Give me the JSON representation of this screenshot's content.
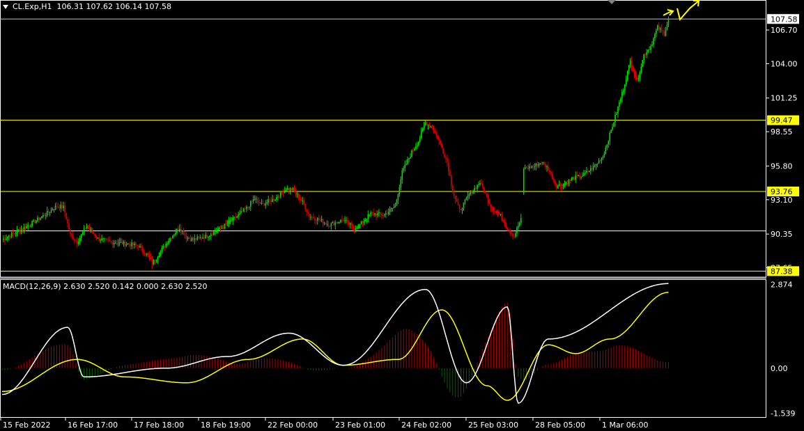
{
  "header": {
    "symbol": "CL.Exp,H1",
    "ohlc": "106.31 107.62 106.14 107.58"
  },
  "macd_header": "MACD(12,26,9) 2.630 2.520 0.142 0.000 2.630 2.520",
  "colors": {
    "background": "#000000",
    "bull_candle": "#00e000",
    "bear_candle": "#e00000",
    "level_line": "#ffff00",
    "price_line": "#c0c0c0",
    "macd_main": "#ffffff",
    "macd_signal": "#ffff00",
    "hist_pos": "#b00000",
    "hist_neg": "#006000",
    "axis_text": "#ffffff"
  },
  "chart_data": [
    {
      "type": "candlestick",
      "title": "CL.Exp,H1",
      "ylim": [
        86.9,
        109.1
      ],
      "y_ticks": [
        "106.70",
        "104.00",
        "101.25",
        "98.55",
        "95.80",
        "93.10",
        "90.35",
        "87.65"
      ],
      "x_tick_labels": [
        "15 Feb 2022",
        "16 Feb 17:00",
        "17 Feb 18:00",
        "18 Feb 19:00",
        "22 Feb 00:00",
        "23 Feb 01:00",
        "24 Feb 02:00",
        "25 Feb 03:00",
        "28 Feb 05:00",
        "1 Mar 06:00"
      ],
      "current_price": "107.58",
      "levels": [
        {
          "value": 99.47,
          "label": "99.47"
        },
        {
          "value": 93.76,
          "label": "93.76"
        },
        {
          "value": 87.38,
          "label": "87.38"
        },
        {
          "value": 90.6,
          "label": ""
        }
      ],
      "close_anchors": [
        [
          0,
          89.9
        ],
        [
          10,
          90.5
        ],
        [
          20,
          91.1
        ],
        [
          30,
          91.8
        ],
        [
          40,
          92.6
        ],
        [
          45,
          92.5
        ],
        [
          50,
          90.3
        ],
        [
          55,
          89.7
        ],
        [
          62,
          91.0
        ],
        [
          70,
          90.0
        ],
        [
          80,
          89.7
        ],
        [
          90,
          89.6
        ],
        [
          100,
          89.4
        ],
        [
          107,
          88.6
        ],
        [
          110,
          88.0
        ],
        [
          115,
          88.8
        ],
        [
          122,
          89.9
        ],
        [
          130,
          90.9
        ],
        [
          135,
          90.1
        ],
        [
          140,
          89.9
        ],
        [
          150,
          90.2
        ],
        [
          160,
          90.8
        ],
        [
          170,
          91.6
        ],
        [
          178,
          92.3
        ],
        [
          185,
          93.2
        ],
        [
          190,
          92.7
        ],
        [
          200,
          93.2
        ],
        [
          208,
          94.0
        ],
        [
          213,
          93.9
        ],
        [
          220,
          92.9
        ],
        [
          225,
          91.8
        ],
        [
          232,
          91.5
        ],
        [
          240,
          91.1
        ],
        [
          250,
          91.5
        ],
        [
          258,
          90.8
        ],
        [
          263,
          91.2
        ],
        [
          270,
          92.0
        ],
        [
          280,
          91.9
        ],
        [
          288,
          92.6
        ],
        [
          293,
          95.3
        ],
        [
          300,
          96.9
        ],
        [
          305,
          97.8
        ],
        [
          310,
          99.3
        ],
        [
          315,
          98.9
        ],
        [
          320,
          97.8
        ],
        [
          326,
          96.1
        ],
        [
          330,
          93.8
        ],
        [
          335,
          92.2
        ],
        [
          342,
          93.5
        ],
        [
          350,
          94.5
        ],
        [
          358,
          92.6
        ],
        [
          365,
          91.8
        ],
        [
          370,
          90.8
        ],
        [
          375,
          90.2
        ],
        [
          378,
          91.0
        ],
        [
          380,
          91.5
        ],
        [
          382,
          95.6
        ],
        [
          390,
          95.8
        ],
        [
          395,
          96.1
        ],
        [
          400,
          95.6
        ],
        [
          406,
          94.2
        ],
        [
          412,
          94.4
        ],
        [
          418,
          94.8
        ],
        [
          426,
          95.1
        ],
        [
          434,
          95.8
        ],
        [
          440,
          96.6
        ],
        [
          445,
          98.3
        ],
        [
          450,
          100.1
        ],
        [
          455,
          102.0
        ],
        [
          460,
          104.2
        ],
        [
          465,
          102.6
        ],
        [
          470,
          104.7
        ],
        [
          475,
          105.4
        ],
        [
          480,
          106.9
        ],
        [
          485,
          106.4
        ],
        [
          488,
          107.6
        ]
      ],
      "gaps": [
        381
      ],
      "arrows": [
        "up",
        "zigzag-up"
      ]
    },
    {
      "type": "line",
      "title": "MACD(12,26,9)",
      "ylim": [
        -1.7,
        3.05
      ],
      "y_ticks": [
        "2.874",
        "0.00",
        "-1.539"
      ],
      "series": [
        {
          "name": "MACD",
          "values": [
            -0.9,
            1.4,
            -0.3,
            0.0,
            0.4,
            1.2,
            0.1,
            2.7,
            -0.5,
            2.1,
            -1.2,
            1.0,
            2.9
          ],
          "x": [
            0,
            48,
            60,
            120,
            165,
            210,
            250,
            310,
            340,
            370,
            378,
            400,
            488
          ]
        },
        {
          "name": "Signal",
          "values": [
            -0.8,
            0.3,
            -0.3,
            -0.5,
            0.3,
            1.0,
            0.1,
            0.3,
            2.0,
            -0.6,
            -1.1,
            0.8,
            0.5,
            1.0,
            2.6
          ],
          "x": [
            0,
            55,
            90,
            135,
            180,
            220,
            250,
            290,
            322,
            355,
            370,
            400,
            420,
            445,
            488
          ]
        }
      ]
    }
  ]
}
